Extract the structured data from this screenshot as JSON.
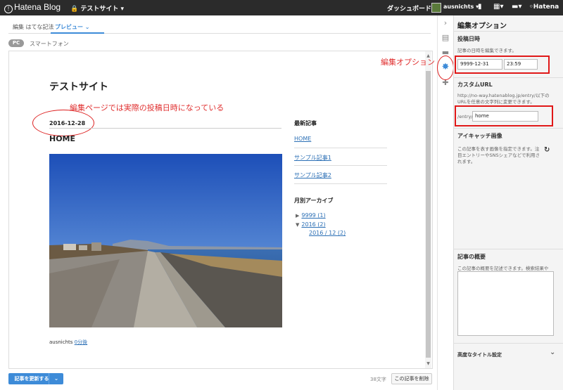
{
  "topbar": {
    "logo": "Hatena Blog",
    "site_menu": "テストサイト",
    "dashboard": "ダッシュボード",
    "user": "ausnichts",
    "hatena": "Hatena"
  },
  "tabs": {
    "edit": "編集 はてな記法",
    "preview": "プレビュー"
  },
  "device": {
    "pc": "PC",
    "smartphone": "スマートフォン"
  },
  "preview": {
    "blog_title": "テストサイト",
    "annotation_date": "編集ページでは実際の投稿日時になっている",
    "date": "2016-12-28",
    "post_title": "HOME",
    "author": "ausnichts",
    "time_ago": "0分後",
    "recent_heading": "最新記事",
    "recent": [
      "HOME",
      "サンプル記事1",
      "サンプル記事2"
    ],
    "archive_heading": "月別アーカイブ",
    "archive": [
      {
        "label": "9999 (1)",
        "expanded": false
      },
      {
        "label": "2016 (2)",
        "expanded": true
      },
      {
        "label": "2016 / 12 (2)",
        "child": true
      }
    ]
  },
  "annotation_options": "編集オプション",
  "panel": {
    "title": "編集オプション",
    "post_date_heading": "投稿日時",
    "post_date_desc": "記事の日時を編集できます。",
    "date_value": "9999-12-31",
    "time_value": "23:59",
    "custom_url_heading": "カスタムURL",
    "custom_url_desc": "http://no-way.hatenablog.jp/entry/以下のURLを任意の文字列に変更できます。",
    "url_prefix": "/entry/",
    "url_value": "home",
    "eyecatch_heading": "アイキャッチ画像",
    "eyecatch_desc": "この記事を表す画像を指定できます。注目エントリーやSNSシェアなどで利用されます。",
    "summary_heading": "記事の概要",
    "summary_desc": "この記事の概要を記述できます。検索結果やSNSシェア、注目エントリーなどで利用されます。",
    "advanced_title": "高度なタイトル設定"
  },
  "footer": {
    "update_button": "記事を更新する",
    "char_count": "38文字",
    "delete_button": "この記事を削除"
  },
  "icons": {
    "collapse": "chevron-right-icon",
    "preview": "window-icon",
    "folder": "folder-icon",
    "gear": "gear-icon",
    "plus": "plus-icon"
  },
  "colors": {
    "accent": "#3d8bd8",
    "annotation": "#e03030",
    "topbar": "#2b2b2b"
  }
}
